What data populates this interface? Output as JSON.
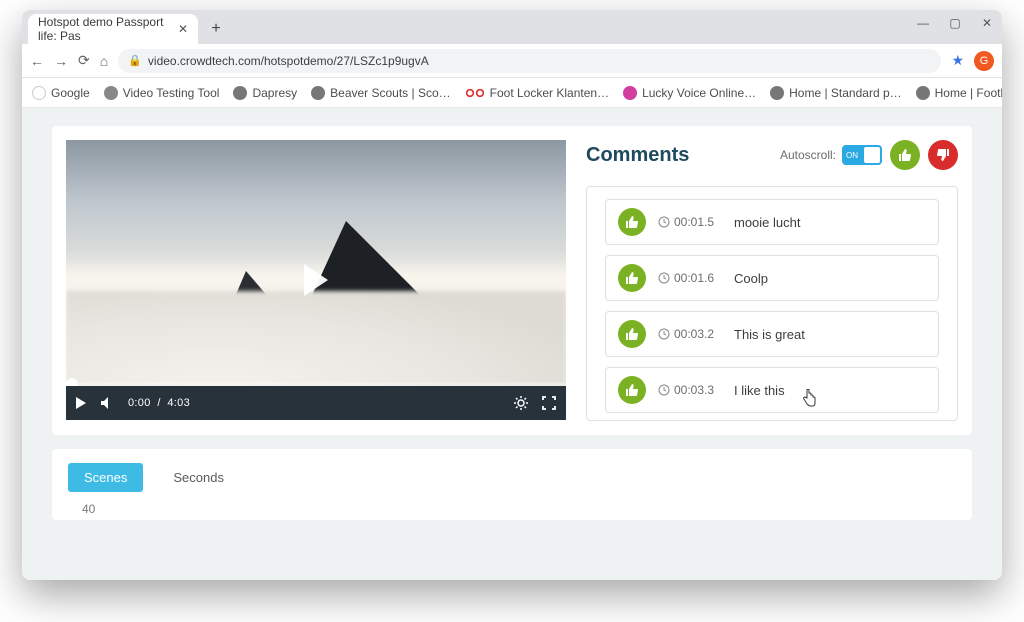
{
  "browser": {
    "tab_title": "Hotspot demo Passport life: Pas",
    "url": "video.crowdtech.com/hotspotdemo/27/LSZc1p9ugvA",
    "avatar_letter": "G",
    "bookmarks": [
      {
        "label": "Google"
      },
      {
        "label": "Video Testing Tool"
      },
      {
        "label": "Dapresy"
      },
      {
        "label": "Beaver Scouts | Sco…"
      },
      {
        "label": "Foot Locker Klanten…"
      },
      {
        "label": "Lucky Voice Online…"
      },
      {
        "label": "Home | Standard p…"
      },
      {
        "label": "Home | Footlocker…"
      }
    ]
  },
  "player": {
    "current_time": "0:00",
    "duration": "4:03"
  },
  "comments": {
    "heading": "Comments",
    "autoscroll_label": "Autoscroll:",
    "autoscroll_state": "ON",
    "items": [
      {
        "timestamp": "00:01.5",
        "text": "mooie lucht",
        "sentiment": "up"
      },
      {
        "timestamp": "00:01.6",
        "text": "Coolp",
        "sentiment": "up"
      },
      {
        "timestamp": "00:03.2",
        "text": "This is great",
        "sentiment": "up"
      },
      {
        "timestamp": "00:03.3",
        "text": "I like this",
        "sentiment": "up"
      }
    ]
  },
  "tabs": {
    "items": [
      {
        "label": "Scenes",
        "active": true
      },
      {
        "label": "Seconds",
        "active": false
      }
    ],
    "value": "40"
  }
}
